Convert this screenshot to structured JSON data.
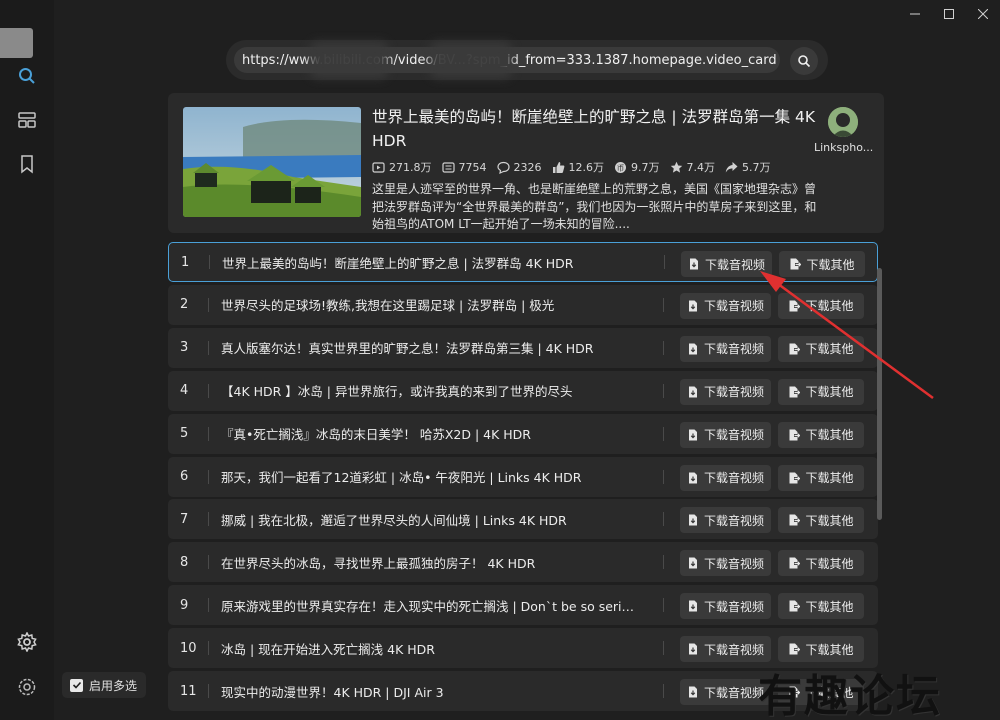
{
  "url_bar": {
    "value": "https://www.bilibili.com/video/BV...?spm_id_from=333.1387.homepage.video_card"
  },
  "video": {
    "title": "世界上最美的岛屿！断崖绝壁上的旷野之息 | 法罗群岛第一集 4K HDR",
    "stats": {
      "plays": "271.8万",
      "danmaku": "7754",
      "comments": "2326",
      "likes": "12.6万",
      "coins": "9.7万",
      "favorites": "7.4万",
      "shares": "5.7万"
    },
    "description": "这里是人迹罕至的世界一角、也是断崖绝壁上的荒野之息，美国《国家地理杂志》曾把法罗群岛评为“全世界最美的群岛”，我们也因为一张照片中的草房子来到这里，和始祖鸟的ATOM LT一起开始了一场未知的冒险....",
    "uploader": "Linkspho..."
  },
  "buttons": {
    "download_av": "下载音视频",
    "download_other": "下载其他"
  },
  "multi_select": {
    "label": "启用多选",
    "checked": true
  },
  "episodes": [
    {
      "num": "1",
      "title": "世界上最美的岛屿！断崖绝壁上的旷野之息 | 法罗群岛 4K HDR"
    },
    {
      "num": "2",
      "title": "世界尽头的足球场!教练,我想在这里踢足球 | 法罗群岛 | 极光"
    },
    {
      "num": "3",
      "title": "真人版塞尔达！真实世界里的旷野之息！法罗群岛第三集 | 4K HDR"
    },
    {
      "num": "4",
      "title": "【4K HDR 】冰岛 | 异世界旅行，或许我真的来到了世界的尽头"
    },
    {
      "num": "5",
      "title": "『真•死亡搁浅』冰岛的末日美学！ 哈苏X2D | 4K HDR"
    },
    {
      "num": "6",
      "title": "那天，我们一起看了12道彩虹 | 冰岛• 午夜阳光 | Links 4K HDR"
    },
    {
      "num": "7",
      "title": "挪威 | 我在北极，邂逅了世界尽头的人间仙境 | Links 4K HDR"
    },
    {
      "num": "8",
      "title": "在世界尽头的冰岛，寻找世界上最孤独的房子！ 4K HDR"
    },
    {
      "num": "9",
      "title": "原来游戏里的世界真实存在！走入现实中的死亡搁浅 | Don`t be so serious ..."
    },
    {
      "num": "10",
      "title": "冰岛 | 现在开始进入死亡搁浅 4K HDR"
    },
    {
      "num": "11",
      "title": "现实中的动漫世界！4K HDR | DJI Air 3"
    }
  ],
  "watermark": "有趣论坛",
  "colors": {
    "background": "#1f1f1f",
    "panel": "#2a2a2a",
    "accent": "#4aa0d8",
    "arrow": "#e03030"
  }
}
